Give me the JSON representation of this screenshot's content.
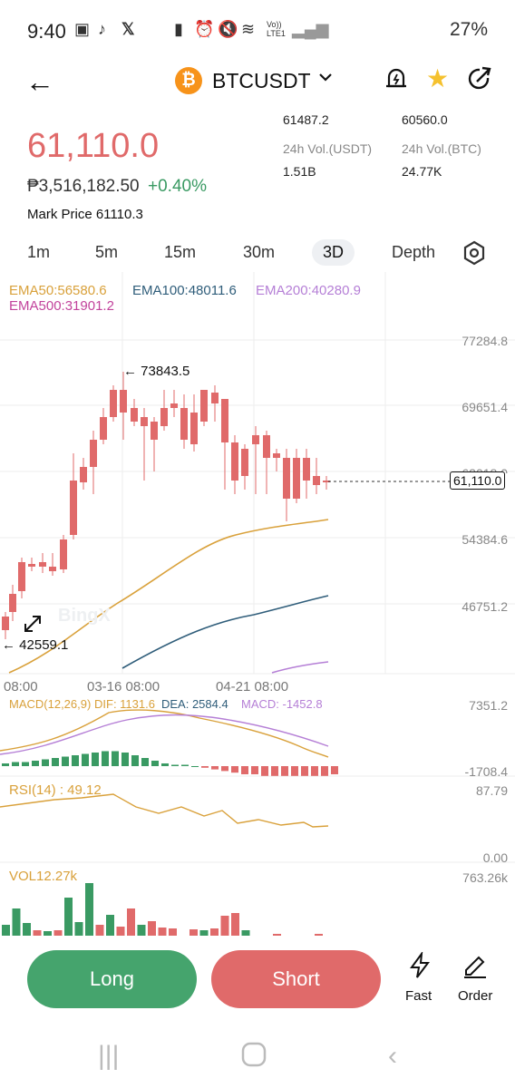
{
  "status_bar": {
    "time": "9:40",
    "network": "Vo)) LTE1",
    "battery": "27%"
  },
  "header": {
    "pair": "BTCUSDT",
    "coin_symbol": "₿",
    "icons": [
      "back-arrow-icon",
      "chevron-down-icon",
      "alert-bell-icon",
      "star-icon",
      "share-icon"
    ]
  },
  "ticker": {
    "last_price": "61,110.0",
    "fiat_price": "₱3,516,182.50",
    "change": "+0.40%",
    "mark_price": "Mark Price 61110.3",
    "high": "61487.2",
    "low": "60560.0",
    "vol_usdt_label": "24h Vol.(USDT)",
    "vol_btc_label": "24h Vol.(BTC)",
    "vol_usdt": "1.51B",
    "vol_btc": "24.77K"
  },
  "tabs": [
    {
      "label": "1m"
    },
    {
      "label": "5m"
    },
    {
      "label": "15m"
    },
    {
      "label": "30m"
    },
    {
      "label": "3D",
      "active": true
    },
    {
      "label": "Depth"
    }
  ],
  "indicators": {
    "ema50": "EMA50:56580.6",
    "ema100": "EMA100:48011.6",
    "ema200": "EMA200:40280.9",
    "ema500": "EMA500:31901.2",
    "macd": "MACD(12,26,9)",
    "dif": "DIF: 1131.6",
    "dea": "DEA: 2584.4",
    "macd_val": "MACD: -1452.8",
    "rsi": "RSI(14) : 49.12",
    "vol": "VOL12.27k"
  },
  "chart_axis": {
    "prices": [
      "77284.8",
      "69651.4",
      "62018.0",
      "54384.6",
      "46751.2"
    ],
    "current": "61,110.0",
    "high_marker": "73843.5",
    "low_marker": "42559.1",
    "dates": [
      "08:00",
      "03-16 08:00",
      "04-21 08:00"
    ],
    "macd_top": "7351.2",
    "macd_bottom": "-1708.4",
    "rsi_top": "87.79",
    "rsi_bottom": "0.00",
    "vol_top": "763.26k",
    "watermark": "BingX"
  },
  "actions": {
    "long": "Long",
    "short": "Short",
    "fast": "Fast",
    "order": "Order"
  },
  "colors": {
    "up": "#3a9a63",
    "down": "#e06a6a",
    "ema50": "#d9a13b",
    "ema100": "#2f5d7a",
    "ema200": "#b57fd6",
    "ema500": "#c2439c"
  }
}
